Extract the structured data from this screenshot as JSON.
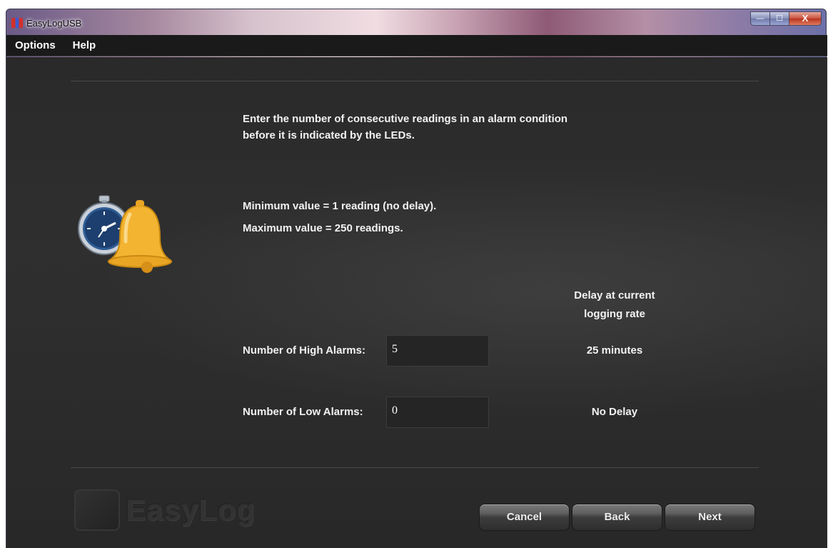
{
  "window": {
    "title": "EasyLogUSB"
  },
  "menu": {
    "options": "Options",
    "help": "Help"
  },
  "instructions": {
    "line1": "Enter the number of consecutive readings in an alarm condition",
    "line2": "before it is indicated by the LEDs.",
    "min_text": "Minimum value = 1 reading (no delay).",
    "max_text": "Maximum value = 250 readings."
  },
  "delay_header": {
    "line1": "Delay at current",
    "line2": "logging rate"
  },
  "high_alarms": {
    "label": "Number of High Alarms:",
    "value": "5",
    "delay": "25 minutes"
  },
  "low_alarms": {
    "label": "Number of Low Alarms:",
    "value": "0",
    "delay": "No Delay"
  },
  "buttons": {
    "cancel": "Cancel",
    "back": "Back",
    "next": "Next"
  },
  "logo": {
    "text": "EasyLog"
  },
  "icons": {
    "app": "app-icon",
    "alarm": "stopwatch-bell-icon",
    "minimize": "minimize-icon",
    "maximize": "maximize-icon",
    "close": "close-icon"
  },
  "colors": {
    "background": "#2c2c2c",
    "text": "#f2f2f2",
    "bell": "#f3b431"
  }
}
